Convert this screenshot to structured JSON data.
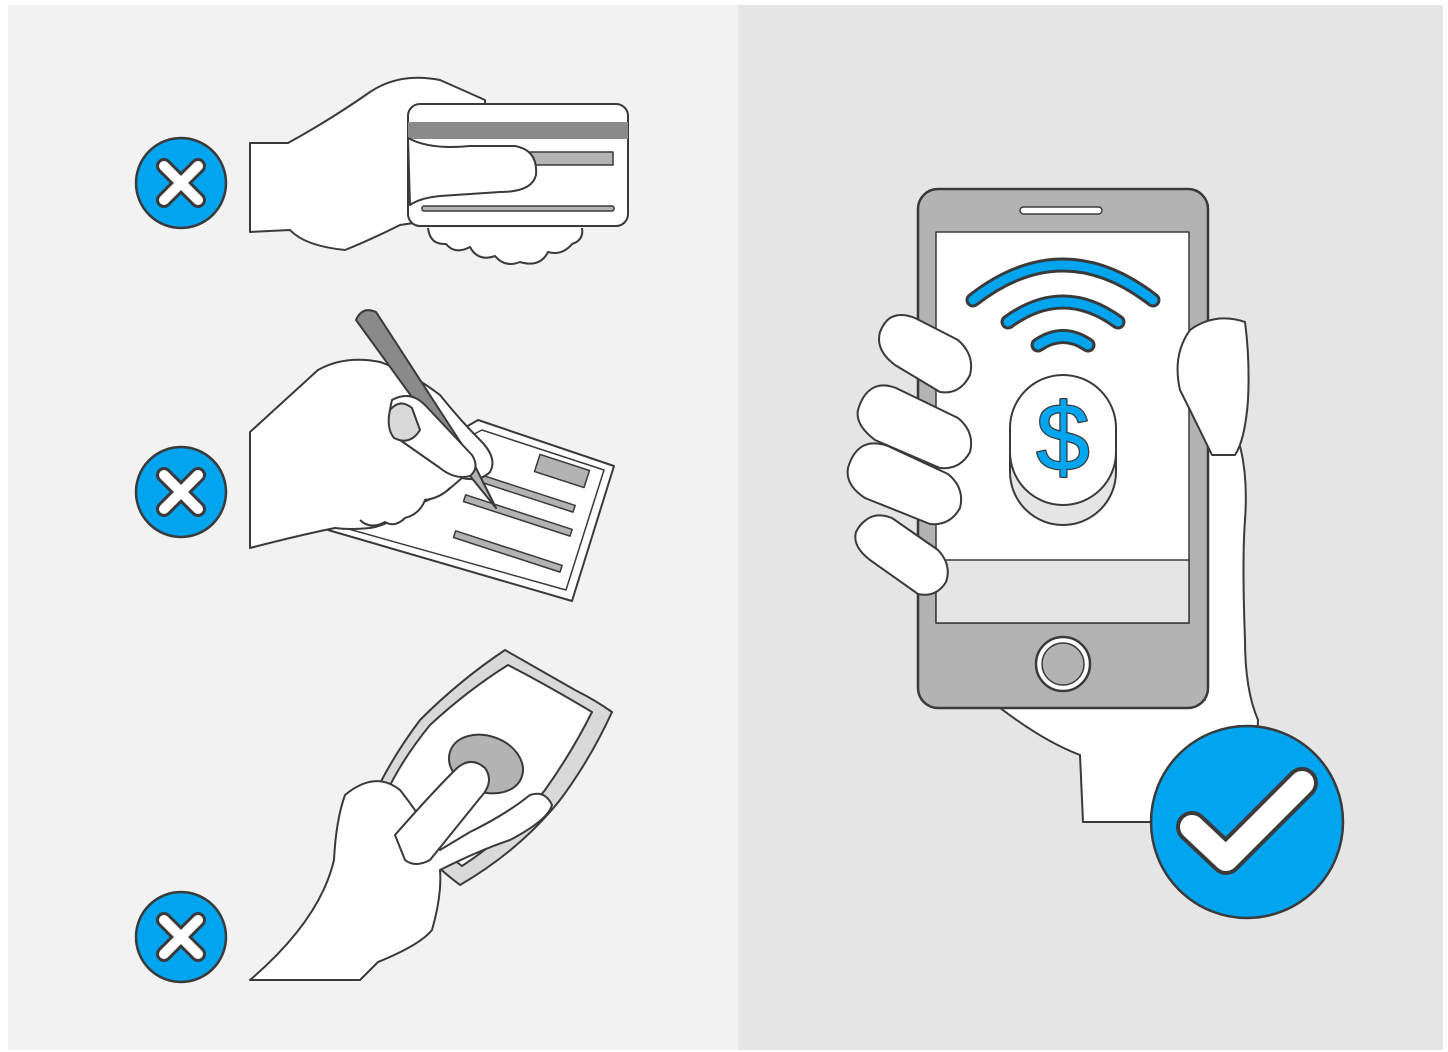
{
  "illustration": {
    "left_panel": {
      "rows": [
        {
          "method": "credit-card",
          "status": "rejected",
          "status_icon": "x-icon"
        },
        {
          "method": "check",
          "status": "rejected",
          "status_icon": "x-icon"
        },
        {
          "method": "cash",
          "status": "rejected",
          "status_icon": "x-icon"
        }
      ]
    },
    "right_panel": {
      "method": "mobile-contactless-payment",
      "status": "approved",
      "status_icon": "checkmark-icon",
      "screen_symbol": "$"
    }
  },
  "colors": {
    "left_bg": "#f2f2f2",
    "right_bg": "#e5e5e5",
    "accent": "#00a4ef",
    "outline": "#3a3a3a",
    "skin": "#ffffff",
    "gray_dark": "#8a8a8a",
    "gray_mid": "#b3b3b3",
    "gray_light": "#d9d9d9"
  }
}
